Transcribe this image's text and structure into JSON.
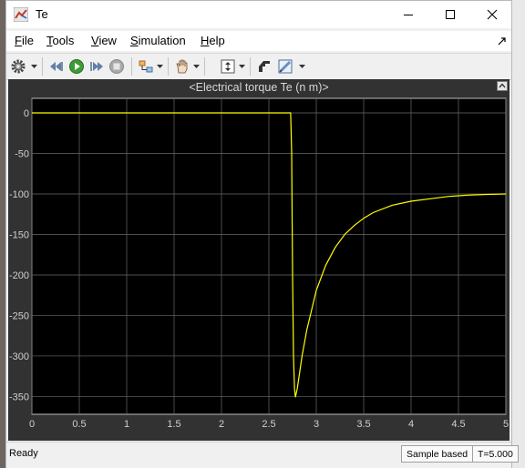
{
  "window": {
    "title": "Te",
    "controls": [
      "minimize-icon",
      "maximize-icon",
      "close-icon"
    ]
  },
  "menu": {
    "file": {
      "underline": "F",
      "rest": "ile"
    },
    "tools": {
      "underline": "T",
      "rest": "ools"
    },
    "view": {
      "underline": "V",
      "rest": "iew"
    },
    "simulation": {
      "underline": "S",
      "rest": "imulation"
    },
    "help": {
      "underline": "H",
      "rest": "elp"
    }
  },
  "toolbar": {
    "icons": [
      "settings-gear-icon",
      "step-back-icon",
      "run-icon",
      "step-forward-icon",
      "stop-icon",
      "signal-selector-icon",
      "zoom-pan-icon",
      "autoscale-icon",
      "highlight-block-icon",
      "style-icon"
    ]
  },
  "scope": {
    "title": "<Electrical torque Te (n m)>"
  },
  "chart_data": {
    "type": "line",
    "title": "<Electrical torque Te (n m)>",
    "xlabel": "",
    "ylabel": "",
    "xlim": [
      0,
      5
    ],
    "ylim": [
      -372,
      18
    ],
    "x_ticks": [
      0,
      0.5,
      1,
      1.5,
      2,
      2.5,
      3,
      3.5,
      4,
      4.5,
      5
    ],
    "x_tick_labels": [
      "0",
      "0.5",
      "1",
      "1.5",
      "2",
      "2.5",
      "3",
      "3.5",
      "4",
      "4.5",
      "5"
    ],
    "y_ticks": [
      0,
      -50,
      -100,
      -150,
      -200,
      -250,
      -300,
      -350
    ],
    "y_tick_labels": [
      "0",
      "-50",
      "-100",
      "-150",
      "-200",
      "-250",
      "-300",
      "-350"
    ],
    "grid": true,
    "line_color": "#ffff00",
    "background": "#000000",
    "series": [
      {
        "name": "",
        "x": [
          0,
          2.73,
          2.74,
          2.745,
          2.75,
          2.76,
          2.77,
          2.78,
          2.8,
          2.85,
          2.9,
          3.0,
          3.1,
          3.2,
          3.3,
          3.4,
          3.5,
          3.6,
          3.8,
          4.0,
          4.2,
          4.4,
          4.6,
          4.8,
          5.0
        ],
        "y": [
          0,
          0,
          -50,
          -130,
          -200,
          -300,
          -340,
          -351,
          -340,
          -300,
          -268,
          -219,
          -188,
          -166,
          -150,
          -139,
          -130,
          -123,
          -114,
          -109,
          -106,
          -103,
          -101.5,
          -100.6,
          -100
        ]
      }
    ]
  },
  "status": {
    "ready": "Ready",
    "sample_mode": "Sample based",
    "time": "T=5.000"
  }
}
